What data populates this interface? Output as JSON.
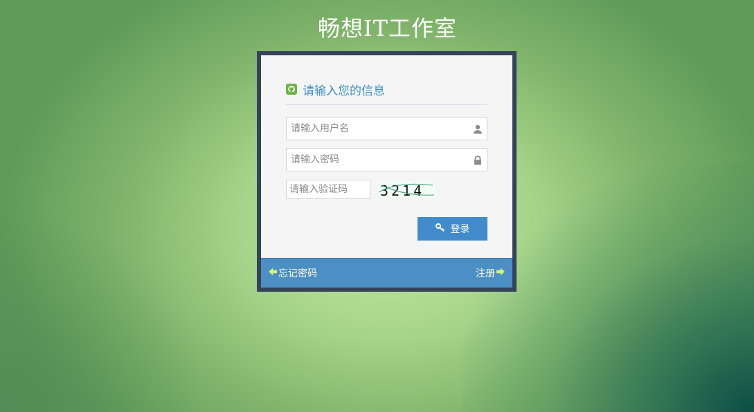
{
  "page": {
    "title": "畅想IT工作室"
  },
  "login": {
    "header_text": "请输入您的信息",
    "username_placeholder": "请输入用户名",
    "password_placeholder": "请输入密码",
    "captcha_placeholder": "请输入验证码",
    "captcha_text": "3214",
    "login_label": "登录"
  },
  "footer": {
    "forgot_password_label": "忘记密码",
    "register_label": "注册"
  },
  "icons": {
    "header": "github-icon",
    "username": "user-icon",
    "password": "lock-icon",
    "login": "key-icon",
    "forgot": "arrow-left-icon",
    "register": "arrow-right-icon"
  },
  "colors": {
    "accent": "#428bca",
    "header_text": "#3f8fc7",
    "frame": "#34425a",
    "footer_bg": "#4b8fc4",
    "header_icon": "#6fb24c",
    "footer_arrow": "#d8f07a",
    "footer_text": "#fffbe0"
  }
}
